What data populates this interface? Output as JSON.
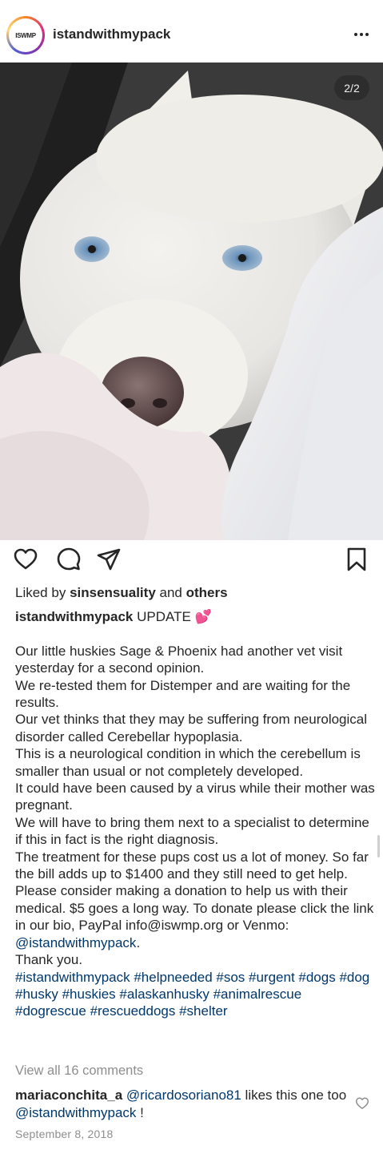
{
  "post": {
    "username": "istandwithmypack",
    "avatar_text": "ISWMP",
    "more_icon": "more-horizontal-icon",
    "slide_counter": "2/2"
  },
  "actions": {
    "like_icon": "heart-icon",
    "comment_icon": "comment-icon",
    "share_icon": "send-icon",
    "save_icon": "bookmark-icon"
  },
  "likes": {
    "prefix": "Liked by",
    "user": "sinsensuality",
    "and": "and",
    "others": "others"
  },
  "caption": {
    "user": "istandwithmypack",
    "headline": "UPDATE 💕",
    "lines": [
      "Our little huskies Sage & Phoenix had another vet visit yesterday for a second opinion.",
      "We re-tested them for Distemper and are waiting for the results.",
      "Our vet thinks that they may be suffering from neurological disorder called Cerebellar hypoplasia.",
      "This is a neurological condition in which the cerebellum is smaller than usual or not completely developed.",
      "It could have been caused by a virus while their mother was pregnant.",
      "We will have to bring them next to a specialist to determine if this in fact is the right diagnosis.",
      "The treatment for these pups cost us a lot of money. So far the bill adds up to $1400 and they still need to get help."
    ],
    "donate_text": "Please consider making a donation to help us with their medical. $5 goes a long way. To donate please click the link in our bio, PayPal info@iswmp.org or Venmo:",
    "venmo_handle": "@istandwithmypack",
    "donate_end": ".",
    "thanks": "Thank you.",
    "hashtags": "#istandwithmypack #helpneeded #sos #urgent #dogs #dog #husky #huskies #alaskanhusky #animalrescue #dogrescue #rescueddogs #shelter"
  },
  "view_all_comments": "View all 16 comments",
  "comment": {
    "user": "mariaconchita_a",
    "mention1": "@ricardosoriano81",
    "text1": "likes this one too",
    "mention2": "@istandwithmypack",
    "text2": "!",
    "like_icon": "heart-small-icon"
  },
  "date": "September 8, 2018",
  "colors": {
    "text": "#262626",
    "link": "#00376b",
    "muted": "#8e8e8e"
  }
}
